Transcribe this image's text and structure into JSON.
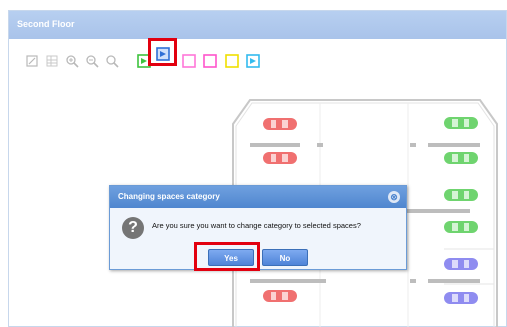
{
  "panel": {
    "title": "Second Floor"
  },
  "toolbar": {
    "buttons": [
      {
        "icon": "edit-icon"
      },
      {
        "icon": "grid-icon"
      },
      {
        "icon": "zoom-in-icon"
      },
      {
        "icon": "zoom-out-icon"
      },
      {
        "icon": "zoom-reset-icon"
      },
      {
        "icon": "flag-green-icon",
        "color": "#3ec33e"
      },
      {
        "icon": "flag-blue-icon",
        "color": "#2f6fd6"
      },
      {
        "icon": "flag-pink-icon",
        "color": "#ff77d8"
      },
      {
        "icon": "flag-magenta-icon",
        "color": "#ff55cc"
      },
      {
        "icon": "flag-yellow-icon",
        "color": "#f0e000"
      },
      {
        "icon": "flag-cyan-icon",
        "color": "#33bbee"
      }
    ]
  },
  "parking": {
    "left_column": [
      {
        "color": "#f07070"
      },
      {
        "color": "#f07070"
      },
      {
        "color": "#f07070"
      }
    ],
    "right_column": [
      {
        "color": "#6fd46f"
      },
      {
        "color": "#6fd46f"
      },
      {
        "color": "#6fd46f"
      },
      {
        "color": "#6fd46f"
      },
      {
        "color": "#8f8cf0"
      },
      {
        "color": "#8f8cf0"
      }
    ]
  },
  "dialog": {
    "title": "Changing spaces category",
    "message": "Are you sure you want to change category to selected spaces?",
    "yes_label": "Yes",
    "no_label": "No",
    "close_label": "⊗"
  }
}
